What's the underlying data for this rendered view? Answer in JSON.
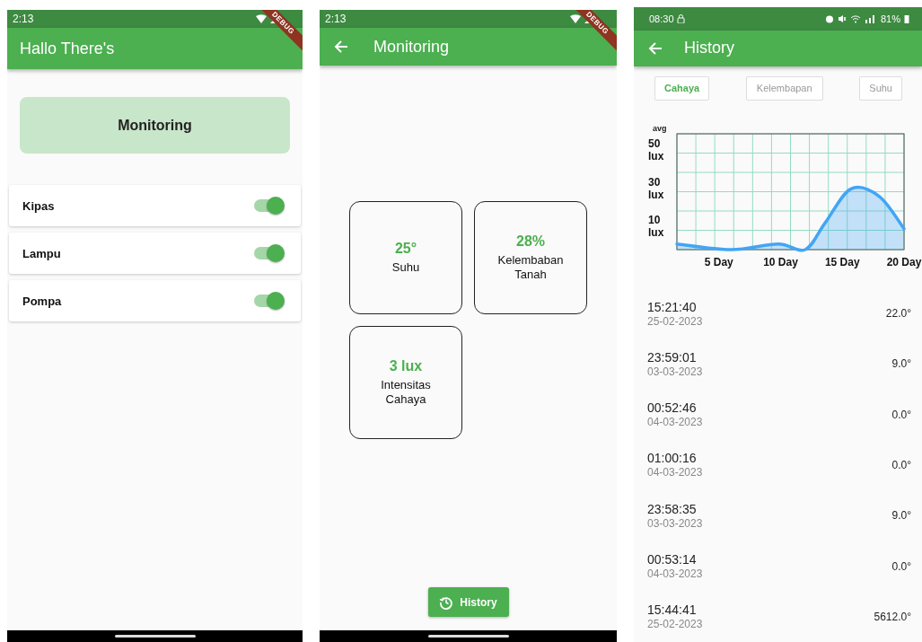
{
  "home": {
    "status_bar": {
      "time": "2:13",
      "debug_banner": "DEBUG"
    },
    "app_bar": {
      "title": "Hallo There's"
    },
    "monitoring_button": {
      "label": "Monitoring"
    },
    "switches": [
      {
        "label": "Kipas",
        "on": true
      },
      {
        "label": "Lampu",
        "on": true
      },
      {
        "label": "Pompa",
        "on": true
      }
    ]
  },
  "monitoring": {
    "status_bar": {
      "time": "2:13",
      "debug_banner": "DEBUG"
    },
    "app_bar": {
      "title": "Monitoring"
    },
    "cards": [
      {
        "value": "25°",
        "label": "Suhu"
      },
      {
        "value": "28%",
        "label": "Kelembaban Tanah"
      },
      {
        "value": "3 lux",
        "label": "Intensitas Cahaya"
      }
    ],
    "history_button": {
      "label": "History"
    }
  },
  "history": {
    "status_bar": {
      "time": "08:30",
      "battery": "81%"
    },
    "app_bar": {
      "title": "History"
    },
    "filter_tabs": [
      {
        "label": "Cahaya",
        "selected": true
      },
      {
        "label": "Kelembapan",
        "selected": false
      },
      {
        "label": "Suhu",
        "selected": false
      }
    ],
    "chart_data": {
      "type": "area",
      "ylabel": "avg",
      "x": [
        1.6,
        6,
        9.8,
        12,
        13.6,
        15.7,
        18,
        20
      ],
      "grid": true,
      "series": [
        {
          "color": "#42a5f5",
          "values": [
            3,
            0,
            3,
            0,
            14,
            32,
            28,
            11
          ]
        }
      ],
      "xlim": [
        1.6,
        20
      ],
      "ylim": [
        0,
        61
      ],
      "xticks": [
        {
          "value": 5,
          "label": "5 Day"
        },
        {
          "value": 10,
          "label": "10 Day"
        },
        {
          "value": 15,
          "label": "15 Day"
        },
        {
          "value": 20,
          "label": "20 Day"
        }
      ],
      "yticks": [
        {
          "value": 10,
          "label": "10 lux"
        },
        {
          "value": 30,
          "label": "30 lux"
        },
        {
          "value": 50,
          "label": "50 lux"
        }
      ]
    },
    "records": [
      {
        "time": "15:21:40",
        "date": "25-02-2023",
        "value": "22.0°"
      },
      {
        "time": "23:59:01",
        "date": "03-03-2023",
        "value": "9.0°"
      },
      {
        "time": "00:52:46",
        "date": "04-03-2023",
        "value": "0.0°"
      },
      {
        "time": "01:00:16",
        "date": "04-03-2023",
        "value": "0.0°"
      },
      {
        "time": "23:58:35",
        "date": "03-03-2023",
        "value": "9.0°"
      },
      {
        "time": "00:53:14",
        "date": "04-03-2023",
        "value": "0.0°"
      },
      {
        "time": "15:44:41",
        "date": "25-02-2023",
        "value": "5612.0°"
      }
    ]
  }
}
